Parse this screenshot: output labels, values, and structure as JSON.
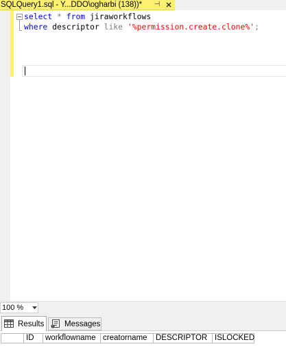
{
  "document_tab": {
    "title": "SQLQuery1.sql - Y...DDO\\ogharbi (138))*",
    "pin_glyph": "⊣",
    "close_icon": "close-icon"
  },
  "editor": {
    "lines": [
      {
        "tokens": [
          {
            "text": "select",
            "kind": "kw"
          },
          {
            "text": " ",
            "kind": "plain"
          },
          {
            "text": "*",
            "kind": "op"
          },
          {
            "text": " ",
            "kind": "plain"
          },
          {
            "text": "from",
            "kind": "kw"
          },
          {
            "text": " jiraworkflows",
            "kind": "plain"
          }
        ]
      },
      {
        "tokens": [
          {
            "text": "where",
            "kind": "kw"
          },
          {
            "text": " descriptor ",
            "kind": "plain"
          },
          {
            "text": "like",
            "kind": "op"
          },
          {
            "text": " ",
            "kind": "plain"
          },
          {
            "text": "'%permission.create.clone%'",
            "kind": "str"
          },
          {
            "text": ";",
            "kind": "op"
          }
        ]
      }
    ],
    "colors": {
      "keyword": "#0000ff",
      "operator": "#808080",
      "string": "#ff0000",
      "changed_track": "#fdf070"
    }
  },
  "zoom": {
    "value": "100 %"
  },
  "results": {
    "tabs": [
      {
        "label": "Results",
        "icon": "grid-icon"
      },
      {
        "label": "Messages",
        "icon": "messages-icon"
      }
    ],
    "columns": [
      "",
      "ID",
      "workflowname",
      "creatorname",
      "DESCRIPTOR",
      "ISLOCKED"
    ]
  }
}
